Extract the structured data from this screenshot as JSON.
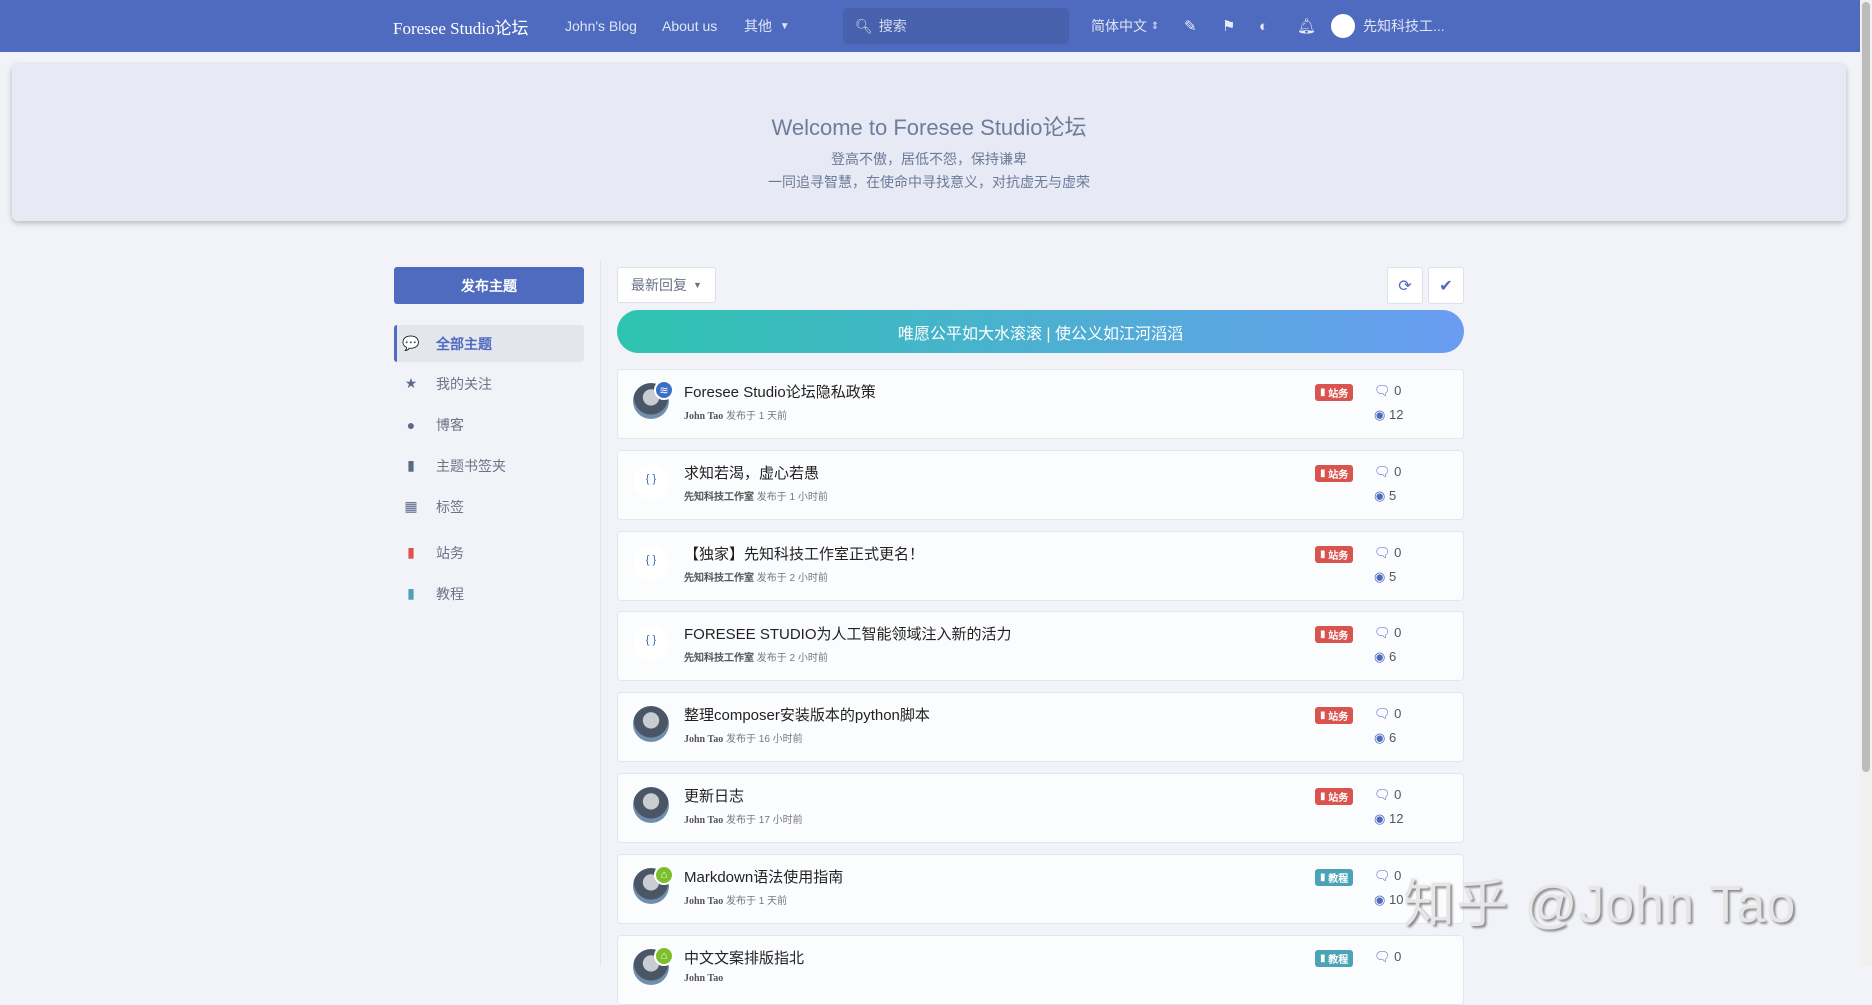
{
  "nav": {
    "brand": "Foresee Studio论坛",
    "links": [
      "John's Blog",
      "About us",
      "其他"
    ],
    "search_placeholder": "搜索",
    "language": "简体中文",
    "user": "先知科技工..."
  },
  "hero": {
    "title": "Welcome to Foresee Studio论坛",
    "line1": "登高不傲，居低不怨，保持谦卑",
    "line2": "一同追寻智慧，在使命中寻找意义，对抗虚无与虚荣"
  },
  "sidebar": {
    "publish": "发布主题",
    "items": [
      {
        "label": "全部主题",
        "icon": "💬"
      },
      {
        "label": "我的关注",
        "icon": "★"
      },
      {
        "label": "博客",
        "icon": "●"
      },
      {
        "label": "主题书签夹",
        "icon": "▮"
      },
      {
        "label": "标签",
        "icon": "▦"
      },
      {
        "label": "站务",
        "icon": "▮"
      },
      {
        "label": "教程",
        "icon": "▮"
      }
    ]
  },
  "toolbar": {
    "sort": "最新回复"
  },
  "banner": "唯愿公平如大水滚滚 | 使公义如江河滔滔",
  "colors": {
    "nav": "#4f6bbf",
    "site": "#d9534f",
    "tutorial": "#4ba3b5"
  },
  "topics": [
    {
      "title": "Foresee Studio论坛隐私政策",
      "author": "John Tao",
      "time": "发布于 1 天前",
      "tag": "站务",
      "comments": "0",
      "views": "12",
      "avatar": "john",
      "sub": "layers"
    },
    {
      "title": "求知若渴，虚心若愚",
      "author": "先知科技工作室",
      "time": "发布于 1 小时前",
      "tag": "站务",
      "comments": "0",
      "views": "5",
      "avatar": "logo"
    },
    {
      "title": "【独家】先知科技工作室正式更名！",
      "author": "先知科技工作室",
      "time": "发布于 2 小时前",
      "tag": "站务",
      "comments": "0",
      "views": "5",
      "avatar": "logo"
    },
    {
      "title": "FORESEE STUDIO为人工智能领域注入新的活力",
      "author": "先知科技工作室",
      "time": "发布于 2 小时前",
      "tag": "站务",
      "comments": "0",
      "views": "6",
      "avatar": "logo"
    },
    {
      "title": "整理composer安装版本的python脚本",
      "author": "John Tao",
      "time": "发布于 16 小时前",
      "tag": "站务",
      "comments": "0",
      "views": "6",
      "avatar": "john"
    },
    {
      "title": "更新日志",
      "author": "John Tao",
      "time": "发布于 17 小时前",
      "tag": "站务",
      "comments": "0",
      "views": "12",
      "avatar": "john"
    },
    {
      "title": "Markdown语法使用指南",
      "author": "John Tao",
      "time": "发布于 1 天前",
      "tag": "教程",
      "comments": "0",
      "views": "10",
      "avatar": "john",
      "sub": "home"
    },
    {
      "title": "中文文案排版指北",
      "author": "John Tao",
      "time": "",
      "tag": "教程",
      "comments": "0",
      "avatar": "john",
      "sub": "home"
    }
  ],
  "watermark": "知乎 @John Tao"
}
